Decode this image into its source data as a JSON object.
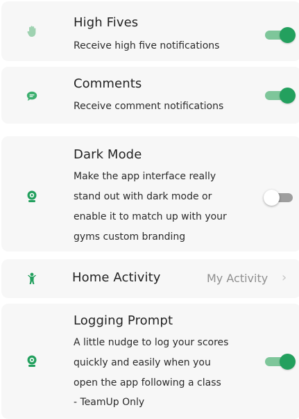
{
  "colors": {
    "accent": "#23a05e",
    "accent_light": "#7ec69a",
    "card_bg": "#f7f7f7",
    "toggle_off": "#9e9e9e",
    "muted_text": "#8f8f8f"
  },
  "settings": [
    {
      "title": "High Fives",
      "description": [
        "Receive high five notifications"
      ],
      "icon": "hand-icon",
      "toggle_on": true
    },
    {
      "title": "Comments",
      "description": [
        "Receive comment notifications"
      ],
      "icon": "comment-icon",
      "toggle_on": true
    },
    {
      "title": "Dark Mode",
      "description": [
        "Make the app interface really",
        "stand out with dark mode or",
        "enable it to match up with your",
        "gyms custom branding"
      ],
      "icon": "webcam-icon",
      "toggle_on": false
    },
    {
      "title": "Home Activity",
      "value": "My Activity",
      "icon": "person-icon",
      "chevron": "›"
    },
    {
      "title": "Logging Prompt",
      "description": [
        "A little nudge to log your scores",
        "quickly and easily when you",
        "open the app following a class",
        "- TeamUp Only"
      ],
      "icon": "webcam-icon",
      "toggle_on": true
    }
  ]
}
